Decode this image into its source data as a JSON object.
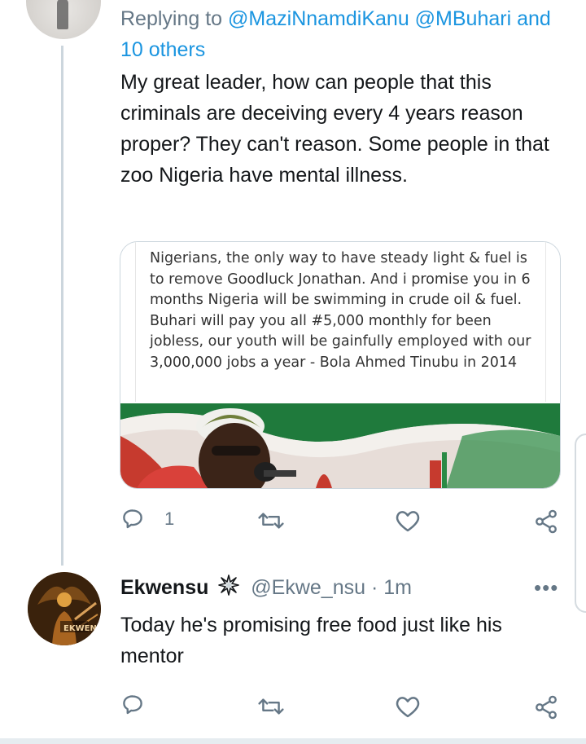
{
  "reply_context": {
    "prefix": "Replying to",
    "mentions": "@MaziNnamdiKanu @MBuhari",
    "others": "and 10 others"
  },
  "tweet1": {
    "text": "My great leader, how can people that this criminals are deceiving every 4 years reason proper? They can't reason. Some people in that zoo Nigeria have mental illness.",
    "media_quote": "Nigerians, the only way to have steady light & fuel is to remove Goodluck Jonathan. And i promise you in 6 months Nigeria will be swimming in crude oil & fuel. Buhari will pay you all #5,000 monthly for been jobless, our youth will be gainfully employed with our 3,000,000 jobs a year - Bola Ahmed Tinubu in 2014",
    "reply_count": "1",
    "icons": [
      "reply-icon",
      "retweet-icon",
      "like-icon",
      "share-icon"
    ]
  },
  "tweet2": {
    "name": "Ekwensu",
    "badge_icon": "sparkle-badge-icon",
    "handle": "@Ekwe_nsu",
    "dot": "·",
    "time": "1m",
    "more": "•••",
    "avatar_text": "EKWEN",
    "text": "Today he's promising free food just like his mentor"
  },
  "colors": {
    "link": "#1b95e0",
    "secondary": "#657786",
    "thread_line": "#ccd6dd"
  }
}
